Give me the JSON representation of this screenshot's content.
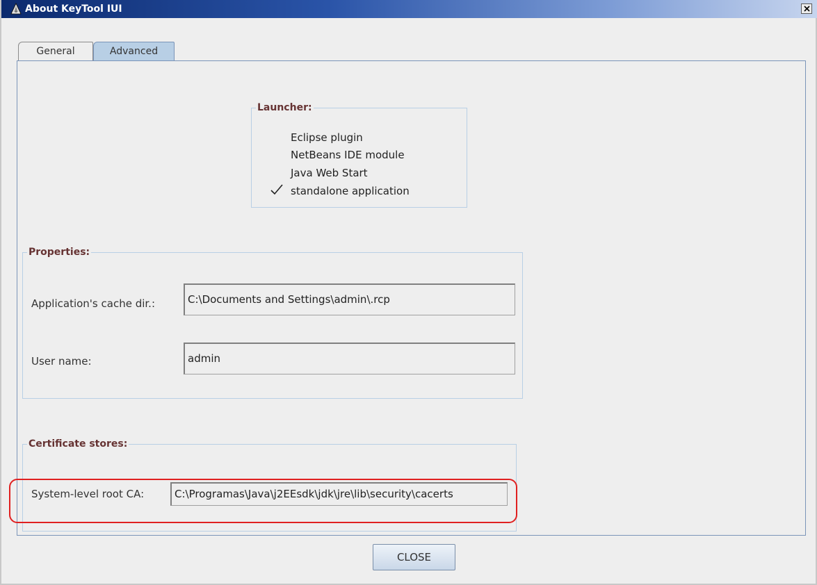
{
  "window": {
    "title": "About KeyTool IUI",
    "close_label": "×"
  },
  "tabs": [
    {
      "label": "General",
      "selected": false
    },
    {
      "label": "Advanced",
      "selected": true
    }
  ],
  "launcher": {
    "title": "Launcher:",
    "items": [
      {
        "label": "Eclipse plugin",
        "checked": false
      },
      {
        "label": "NetBeans IDE module",
        "checked": false
      },
      {
        "label": "Java Web Start",
        "checked": false
      },
      {
        "label": "standalone application",
        "checked": true
      }
    ]
  },
  "properties": {
    "title": "Properties:",
    "cache_dir_label": "Application's cache dir.:",
    "cache_dir_value": "C:\\Documents and Settings\\admin\\.rcp",
    "user_name_label": "User name:",
    "user_name_value": "admin"
  },
  "certificate_stores": {
    "title": "Certificate stores:",
    "root_ca_label": "System-level root CA:",
    "root_ca_value": "C:\\Programas\\Java\\j2EEsdk\\jdk\\jre\\lib\\security\\cacerts"
  },
  "buttons": {
    "close_label": "CLOSE"
  },
  "colors": {
    "group_title": "#663333",
    "highlight": "#e02020",
    "selected_tab": "#b8cfe5"
  }
}
